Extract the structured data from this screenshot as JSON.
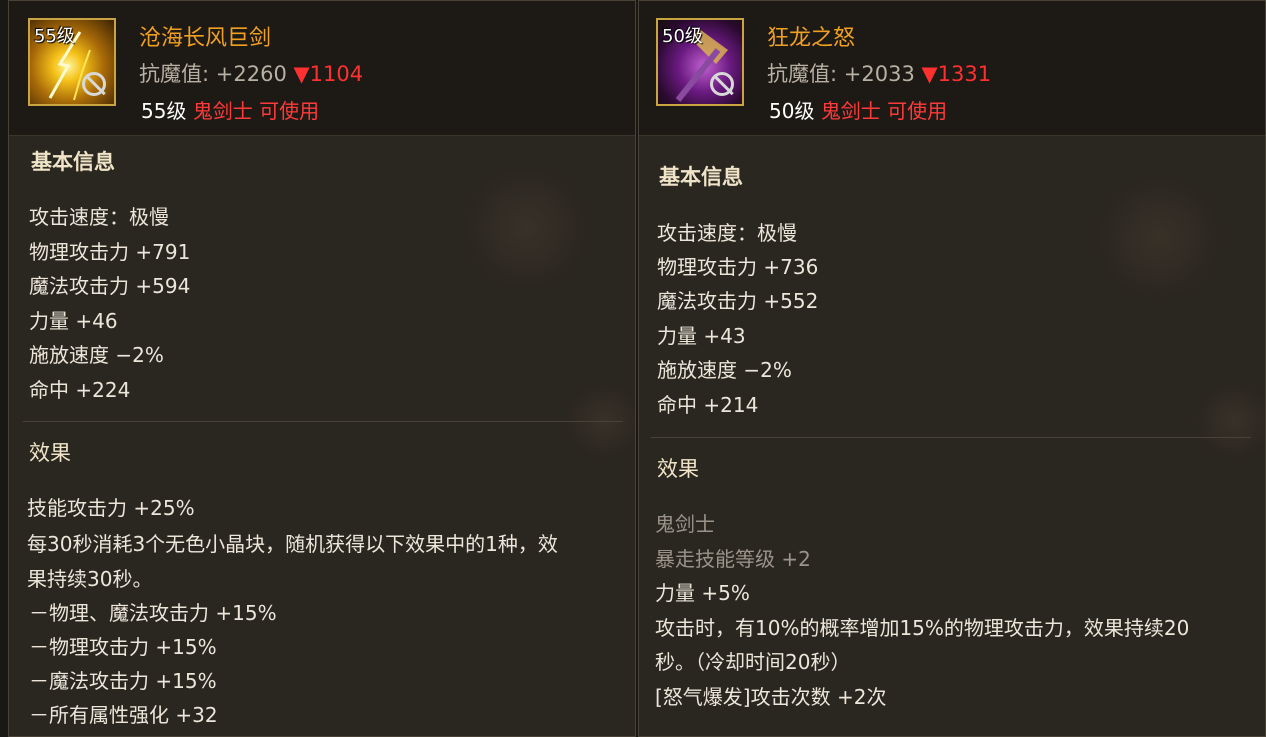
{
  "left": {
    "icon": {
      "level_badge": "55级",
      "name": "sword-icon"
    },
    "name": "沧海长风巨剑",
    "resist_label": "抗魔值:",
    "resist_value": "+2260",
    "resist_diff": "▼1104",
    "req_level": "55级",
    "req_class": "鬼剑士",
    "req_usable": "可使用",
    "basic_title": "基本信息",
    "basic": [
      "攻击速度：极慢",
      "物理攻击力 +791",
      "魔法攻击力 +594",
      "力量 +46",
      "施放速度 −2%",
      "命中 +224"
    ],
    "effect_title": "效果",
    "effects": [
      "技能攻击力 +25%",
      "每30秒消耗3个无色小晶块，随机获得以下效果中的1种，效",
      "果持续30秒。",
      "－物理、魔法攻击力 +15%",
      "－物理攻击力 +15%",
      "－魔法攻击力 +15%",
      "－所有属性强化 +32"
    ]
  },
  "right": {
    "icon": {
      "level_badge": "50级",
      "name": "axe-icon"
    },
    "name": "狂龙之怒",
    "resist_label": "抗魔值:",
    "resist_value": "+2033",
    "resist_diff": "▼1331",
    "req_level": "50级",
    "req_class": "鬼剑士",
    "req_usable": "可使用",
    "basic_title": "基本信息",
    "basic": [
      "攻击速度：极慢",
      "物理攻击力 +736",
      "魔法攻击力 +552",
      "力量 +43",
      "施放速度 −2%",
      "命中 +214"
    ],
    "effect_title": "效果",
    "effects_gray": [
      "鬼剑士",
      "暴走技能等级 +2"
    ],
    "effects": [
      "力量 +5%",
      "攻击时，有10%的概率增加15%的物理攻击力，效果持续20",
      "秒。（冷却时间20秒）",
      "[怒气爆发]攻击次数 +2次"
    ]
  },
  "colors": {
    "name": "#f0a020",
    "diff": "#ff3030",
    "restricted_class": "#ff3a3a",
    "gold_border": "#c9a440"
  }
}
